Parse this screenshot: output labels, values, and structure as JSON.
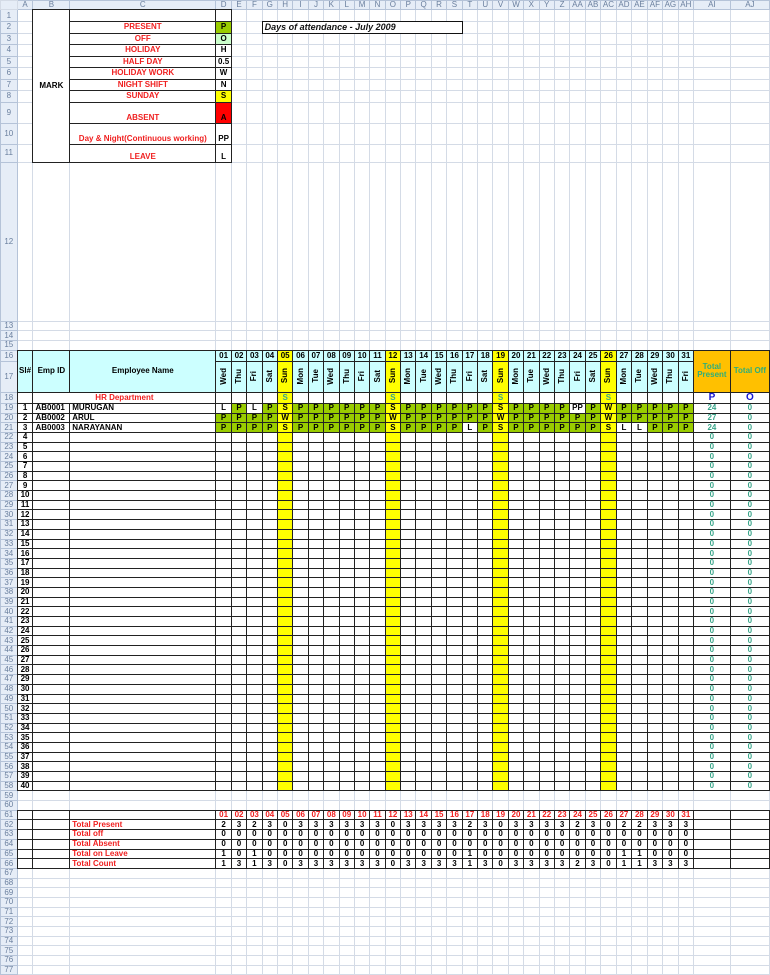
{
  "column_letters": [
    "A",
    "B",
    "C",
    "D",
    "E",
    "F",
    "G",
    "H",
    "I",
    "J",
    "K",
    "L",
    "M",
    "N",
    "O",
    "P",
    "Q",
    "R",
    "S",
    "T",
    "U",
    "V",
    "W",
    "X",
    "Y",
    "Z",
    "AA",
    "AB",
    "AC",
    "AD",
    "AE",
    "AF",
    "AG",
    "AH",
    "AI",
    "AJ"
  ],
  "row_count": 77,
  "title": "Days of attendance - July 2009",
  "legend": {
    "group_label": "MARK",
    "items": [
      {
        "label": "PRESENT",
        "code": "P",
        "color": "#99cc00"
      },
      {
        "label": "OFF",
        "code": "O",
        "color": "#ccffcc"
      },
      {
        "label": "HOLIDAY",
        "code": "H",
        "color": ""
      },
      {
        "label": "HALF DAY",
        "code": "0.5",
        "color": ""
      },
      {
        "label": "HOLIDAY WORK",
        "code": "W",
        "color": ""
      },
      {
        "label": "NIGHT SHIFT",
        "code": "N",
        "color": ""
      },
      {
        "label": "SUNDAY",
        "code": "S",
        "color": "#ffff00"
      },
      {
        "label": "ABSENT",
        "code": "A",
        "color": "#ff0000"
      },
      {
        "label": "Day & Night(Continuous working)",
        "code": "PP",
        "color": ""
      },
      {
        "label": "LEAVE",
        "code": "L",
        "color": ""
      }
    ]
  },
  "headers": {
    "sl": "Sl#",
    "emp_id": "Emp ID",
    "name": "Employee Name",
    "total_present": "Total Present",
    "total_off": "Total Off"
  },
  "days": [
    "01",
    "02",
    "03",
    "04",
    "05",
    "06",
    "07",
    "08",
    "09",
    "10",
    "11",
    "12",
    "13",
    "14",
    "15",
    "16",
    "17",
    "18",
    "19",
    "20",
    "21",
    "22",
    "23",
    "24",
    "25",
    "26",
    "27",
    "28",
    "29",
    "30",
    "31"
  ],
  "weekdays": [
    "Wed",
    "Thu",
    "Fri",
    "Sat",
    "Sun",
    "Mon",
    "Tue",
    "Wed",
    "Thu",
    "Fri",
    "Sat",
    "Sun",
    "Mon",
    "Tue",
    "Wed",
    "Thu",
    "Fri",
    "Sat",
    "Sun",
    "Mon",
    "Tue",
    "Wed",
    "Thu",
    "Fri",
    "Sat",
    "Sun",
    "Mon",
    "Tue",
    "Wed",
    "Thu",
    "Fri"
  ],
  "department": {
    "name": "HR Department",
    "sunday_mark": "S",
    "present_code": "P",
    "off_code": "O"
  },
  "employees": [
    {
      "sl": "1",
      "id": "AB0001",
      "name": "MURUGAN",
      "total_present": "24",
      "total_off": "0",
      "attendance": [
        "L",
        "P",
        "L",
        "P",
        "S",
        "P",
        "P",
        "P",
        "P",
        "P",
        "P",
        "S",
        "P",
        "P",
        "P",
        "P",
        "P",
        "P",
        "S",
        "P",
        "P",
        "P",
        "P",
        "PP",
        "P",
        "W",
        "P",
        "P",
        "P",
        "P",
        "P"
      ]
    },
    {
      "sl": "2",
      "id": "AB0002",
      "name": "ARUL",
      "total_present": "27",
      "total_off": "0",
      "attendance": [
        "P",
        "P",
        "P",
        "P",
        "W",
        "P",
        "P",
        "P",
        "P",
        "P",
        "P",
        "W",
        "P",
        "P",
        "P",
        "P",
        "P",
        "P",
        "W",
        "P",
        "P",
        "P",
        "P",
        "P",
        "P",
        "W",
        "P",
        "P",
        "P",
        "P",
        "P"
      ]
    },
    {
      "sl": "3",
      "id": "AB0003",
      "name": "NARAYANAN",
      "total_present": "24",
      "total_off": "0",
      "attendance": [
        "P",
        "P",
        "P",
        "P",
        "S",
        "P",
        "P",
        "P",
        "P",
        "P",
        "P",
        "S",
        "P",
        "P",
        "P",
        "P",
        "L",
        "P",
        "S",
        "P",
        "P",
        "P",
        "P",
        "P",
        "P",
        "S",
        "L",
        "L",
        "P",
        "P",
        "P"
      ]
    }
  ],
  "empty_rows": {
    "first_sl": 4,
    "last_sl": 40,
    "total_present": "0",
    "total_off": "0"
  },
  "summary": [
    {
      "label": "Total Present",
      "values": [
        "2",
        "3",
        "2",
        "3",
        "0",
        "3",
        "3",
        "3",
        "3",
        "3",
        "3",
        "0",
        "3",
        "3",
        "3",
        "3",
        "2",
        "3",
        "0",
        "3",
        "3",
        "3",
        "3",
        "2",
        "3",
        "0",
        "2",
        "2",
        "3",
        "3",
        "3"
      ]
    },
    {
      "label": "Total off",
      "values": [
        "0",
        "0",
        "0",
        "0",
        "0",
        "0",
        "0",
        "0",
        "0",
        "0",
        "0",
        "0",
        "0",
        "0",
        "0",
        "0",
        "0",
        "0",
        "0",
        "0",
        "0",
        "0",
        "0",
        "0",
        "0",
        "0",
        "0",
        "0",
        "0",
        "0",
        "0"
      ]
    },
    {
      "label": "Total Absent",
      "values": [
        "0",
        "0",
        "0",
        "0",
        "0",
        "0",
        "0",
        "0",
        "0",
        "0",
        "0",
        "0",
        "0",
        "0",
        "0",
        "0",
        "0",
        "0",
        "0",
        "0",
        "0",
        "0",
        "0",
        "0",
        "0",
        "0",
        "0",
        "0",
        "0",
        "0",
        "0"
      ]
    },
    {
      "label": "Total on Leave",
      "values": [
        "1",
        "0",
        "1",
        "0",
        "0",
        "0",
        "0",
        "0",
        "0",
        "0",
        "0",
        "0",
        "0",
        "0",
        "0",
        "0",
        "1",
        "0",
        "0",
        "0",
        "0",
        "0",
        "0",
        "0",
        "0",
        "0",
        "1",
        "1",
        "0",
        "0",
        "0"
      ]
    },
    {
      "label": "Total Count",
      "values": [
        "1",
        "3",
        "1",
        "3",
        "0",
        "3",
        "3",
        "3",
        "3",
        "3",
        "3",
        "0",
        "3",
        "3",
        "3",
        "3",
        "1",
        "3",
        "0",
        "3",
        "3",
        "3",
        "3",
        "2",
        "3",
        "0",
        "1",
        "1",
        "3",
        "3",
        "3"
      ]
    }
  ]
}
